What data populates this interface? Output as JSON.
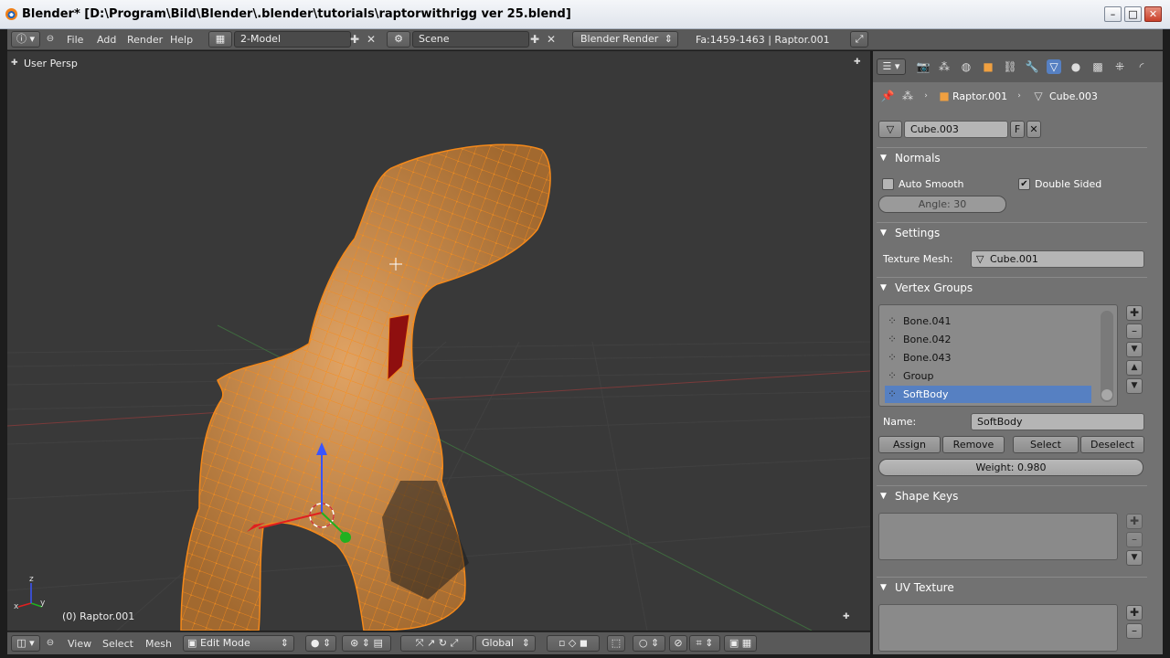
{
  "window": {
    "title": "Blender* [D:\\Program\\Bild\\Blender\\.blender\\tutorials\\raptorwithrigg ver 25.blend]",
    "minimize": "–",
    "maximize": "□",
    "close": "✕"
  },
  "topbar": {
    "menus": [
      "File",
      "Add",
      "Render",
      "Help"
    ],
    "screen_layout": "2-Model",
    "scene": "Scene",
    "render_engine": "Blender Render",
    "stats": "Fa:1459-1463 | Raptor.001"
  },
  "viewport": {
    "view_name": "User Persp",
    "object_info": "(0) Raptor.001"
  },
  "bottombar": {
    "menus": [
      "View",
      "Select",
      "Mesh"
    ],
    "mode": "Edit Mode",
    "orientation": "Global"
  },
  "properties": {
    "breadcrumb": {
      "object": "Raptor.001",
      "mesh": "Cube.003"
    },
    "datablock": {
      "name": "Cube.003",
      "fake_user": "F"
    },
    "normals": {
      "header": "Normals",
      "auto_smooth_label": "Auto Smooth",
      "auto_smooth": false,
      "double_sided_label": "Double Sided",
      "double_sided": true,
      "angle": "Angle: 30"
    },
    "settings": {
      "header": "Settings",
      "texture_mesh_label": "Texture Mesh:",
      "texture_mesh": "Cube.001"
    },
    "vertex_groups": {
      "header": "Vertex Groups",
      "items": [
        "Bone.041",
        "Bone.042",
        "Bone.043",
        "Group",
        "SoftBody"
      ],
      "selected_index": 4,
      "name_label": "Name:",
      "name_value": "SoftBody",
      "assign": "Assign",
      "remove": "Remove",
      "select": "Select",
      "deselect": "Deselect",
      "weight": "Weight: 0.980"
    },
    "shape_keys": {
      "header": "Shape Keys"
    },
    "uv_texture": {
      "header": "UV Texture"
    }
  },
  "colors": {
    "wire": "#f5891a",
    "mesh": "#c78a4c",
    "selected_faces": "#8f0f0f",
    "selection_blue": "#5680c2"
  }
}
